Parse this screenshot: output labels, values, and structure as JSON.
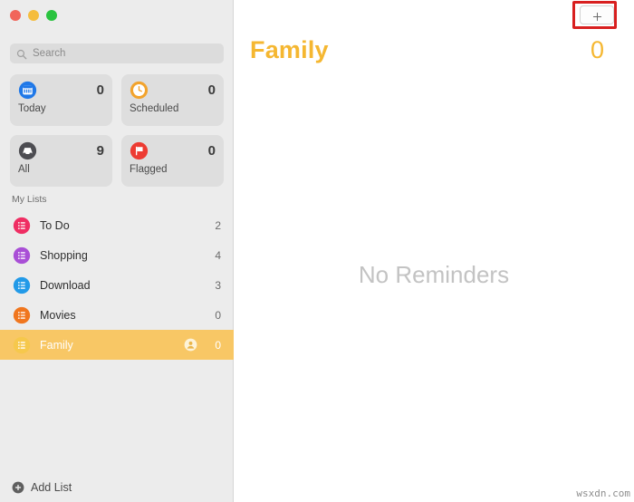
{
  "window": {
    "traffic_lights": [
      {
        "name": "close",
        "color": "#f1655a"
      },
      {
        "name": "minimize",
        "color": "#f5bd3e"
      },
      {
        "name": "maximize",
        "color": "#2ac33f"
      }
    ]
  },
  "sidebar": {
    "search": {
      "placeholder": "Search",
      "value": "",
      "icon": "search-icon"
    },
    "smart_cards": [
      {
        "label": "Today",
        "count": "0",
        "icon": "calendar-icon",
        "color": "#1f78e8"
      },
      {
        "label": "Scheduled",
        "count": "0",
        "icon": "clock-icon",
        "color": "#f2a32c"
      },
      {
        "label": "All",
        "count": "9",
        "icon": "inbox-icon",
        "color": "#4d4d52"
      },
      {
        "label": "Flagged",
        "count": "0",
        "icon": "flag-icon",
        "color": "#ed3b32"
      }
    ],
    "lists_header": "My Lists",
    "lists": [
      {
        "label": "To Do",
        "count": "2",
        "icon": "list-icon",
        "color": "#ef2e63",
        "selected": false,
        "shared": false
      },
      {
        "label": "Shopping",
        "count": "4",
        "icon": "list-icon",
        "color": "#a94fd6",
        "selected": false,
        "shared": false
      },
      {
        "label": "Download",
        "count": "3",
        "icon": "list-icon",
        "color": "#229ae8",
        "selected": false,
        "shared": false
      },
      {
        "label": "Movies",
        "count": "0",
        "icon": "list-icon",
        "color": "#f0761e",
        "selected": false,
        "shared": false
      },
      {
        "label": "Family",
        "count": "0",
        "icon": "list-icon",
        "color": "#f6c84c",
        "selected": true,
        "shared": true
      }
    ],
    "add_list": {
      "label": "Add List",
      "icon": "plus-circle-icon"
    }
  },
  "main": {
    "add_button": {
      "icon": "plus-icon",
      "label": ""
    },
    "annotation": {
      "color": "#d81f1f",
      "target": "add-reminder-button"
    },
    "title": "Family",
    "count": "0",
    "empty_state": "No Reminders",
    "accent_color": "#f5b731"
  },
  "watermark": "wsxdn.com"
}
